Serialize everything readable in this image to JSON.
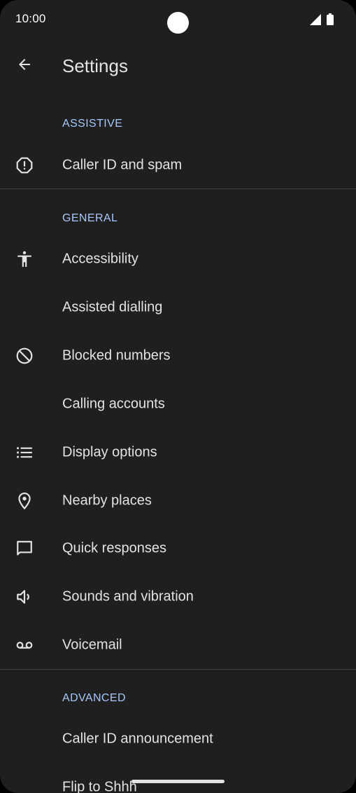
{
  "status_bar": {
    "time": "10:00"
  },
  "app_bar": {
    "title": "Settings"
  },
  "sections": {
    "assistive": "ASSISTIVE",
    "general": "GENERAL",
    "advanced": "ADVANCED"
  },
  "items": {
    "caller_id_spam": {
      "label": "Caller ID and spam",
      "icon": "alert-octagon-icon"
    },
    "accessibility": {
      "label": "Accessibility",
      "icon": "accessibility-icon"
    },
    "assisted_dialling": {
      "label": "Assisted dialling"
    },
    "blocked_numbers": {
      "label": "Blocked numbers",
      "icon": "block-icon"
    },
    "calling_accounts": {
      "label": "Calling accounts"
    },
    "display_options": {
      "label": "Display options",
      "icon": "list-icon"
    },
    "nearby_places": {
      "label": "Nearby places",
      "icon": "location-pin-icon"
    },
    "quick_responses": {
      "label": "Quick responses",
      "icon": "chat-bubble-icon"
    },
    "sounds_vibration": {
      "label": "Sounds and vibration",
      "icon": "volume-icon"
    },
    "voicemail": {
      "label": "Voicemail",
      "icon": "voicemail-icon"
    },
    "caller_id_announcement": {
      "label": "Caller ID announcement"
    },
    "flip_to_shhh": {
      "label": "Flip to Shhh"
    }
  },
  "colors": {
    "background": "#1f1f1f",
    "text": "#e3e3e3",
    "section_accent": "#a8c7fa",
    "divider": "#3c3c3c"
  }
}
